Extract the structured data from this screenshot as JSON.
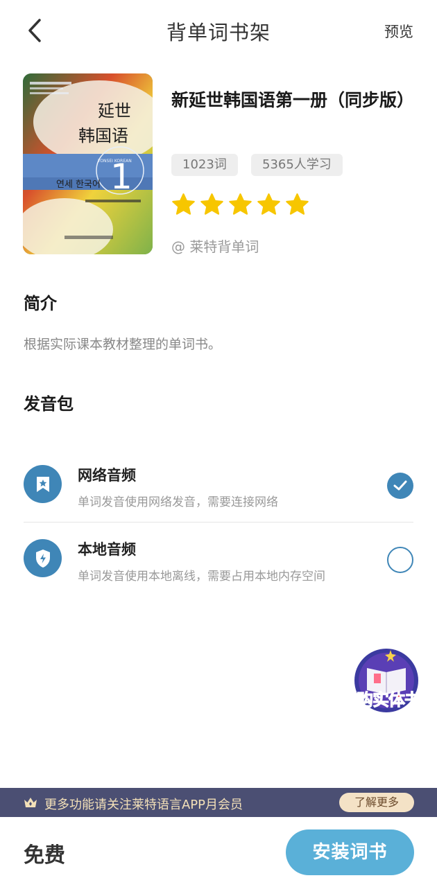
{
  "header": {
    "title": "背单词书架",
    "preview_label": "预览",
    "back_icon": "chevron-left-icon"
  },
  "book": {
    "title": "新延世韩国语第一册（同步版）",
    "cover": {
      "title_line1": "延世",
      "title_line2": "韩国语",
      "volume": "1",
      "korean_title": "연세 한국어",
      "roman_title": "YONSEI KOREAN"
    },
    "word_count": "1023词",
    "learners": "5365人学习",
    "rating": 5,
    "publisher": "@ 莱特背单词"
  },
  "intro": {
    "heading": "简介",
    "text": "根据实际课本教材整理的单词书。"
  },
  "audio": {
    "heading": "发音包",
    "options": [
      {
        "name": "网络音频",
        "desc": "单词发音使用网络发音，需要连接网络",
        "icon": "bookmark-icon",
        "selected": true
      },
      {
        "name": "本地音频",
        "desc": "单词发音使用本地离线，需要占用本地内存空间",
        "icon": "shield-bolt-icon",
        "selected": false
      }
    ]
  },
  "float_buy": {
    "label": "购实体书"
  },
  "member_bar": {
    "text": "更多功能请关注莱特语言APP月会员",
    "button": "了解更多",
    "icon": "crown-icon"
  },
  "footer": {
    "price": "免费",
    "install_label": "安装词书"
  },
  "colors": {
    "accent": "#3f86b7",
    "install_button": "#5ab0d8",
    "star": "#f7c600",
    "member_bar": "#4b4f73"
  }
}
